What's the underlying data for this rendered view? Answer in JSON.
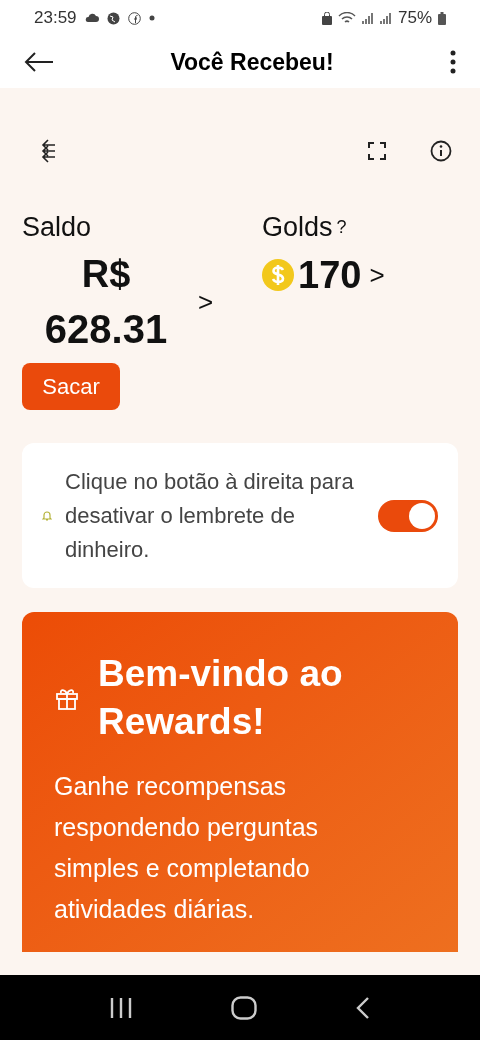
{
  "status_bar": {
    "time": "23:59",
    "battery": "75%"
  },
  "app_bar": {
    "title": "Você Recebeu!"
  },
  "balance": {
    "label": "Saldo",
    "currency": "R$",
    "amount": "628.31",
    "chevron": ">",
    "button": "Sacar"
  },
  "golds": {
    "label": "Golds",
    "help": "?",
    "amount": "170",
    "chevron": ">"
  },
  "reminder": {
    "text": "Clique no botão à direita para desativar o lembrete de dinheiro.",
    "on": true
  },
  "welcome": {
    "title": "Bem-vindo ao Rewards!",
    "body": "Ganhe recompensas respondendo perguntas simples e completando atividades diárias."
  }
}
